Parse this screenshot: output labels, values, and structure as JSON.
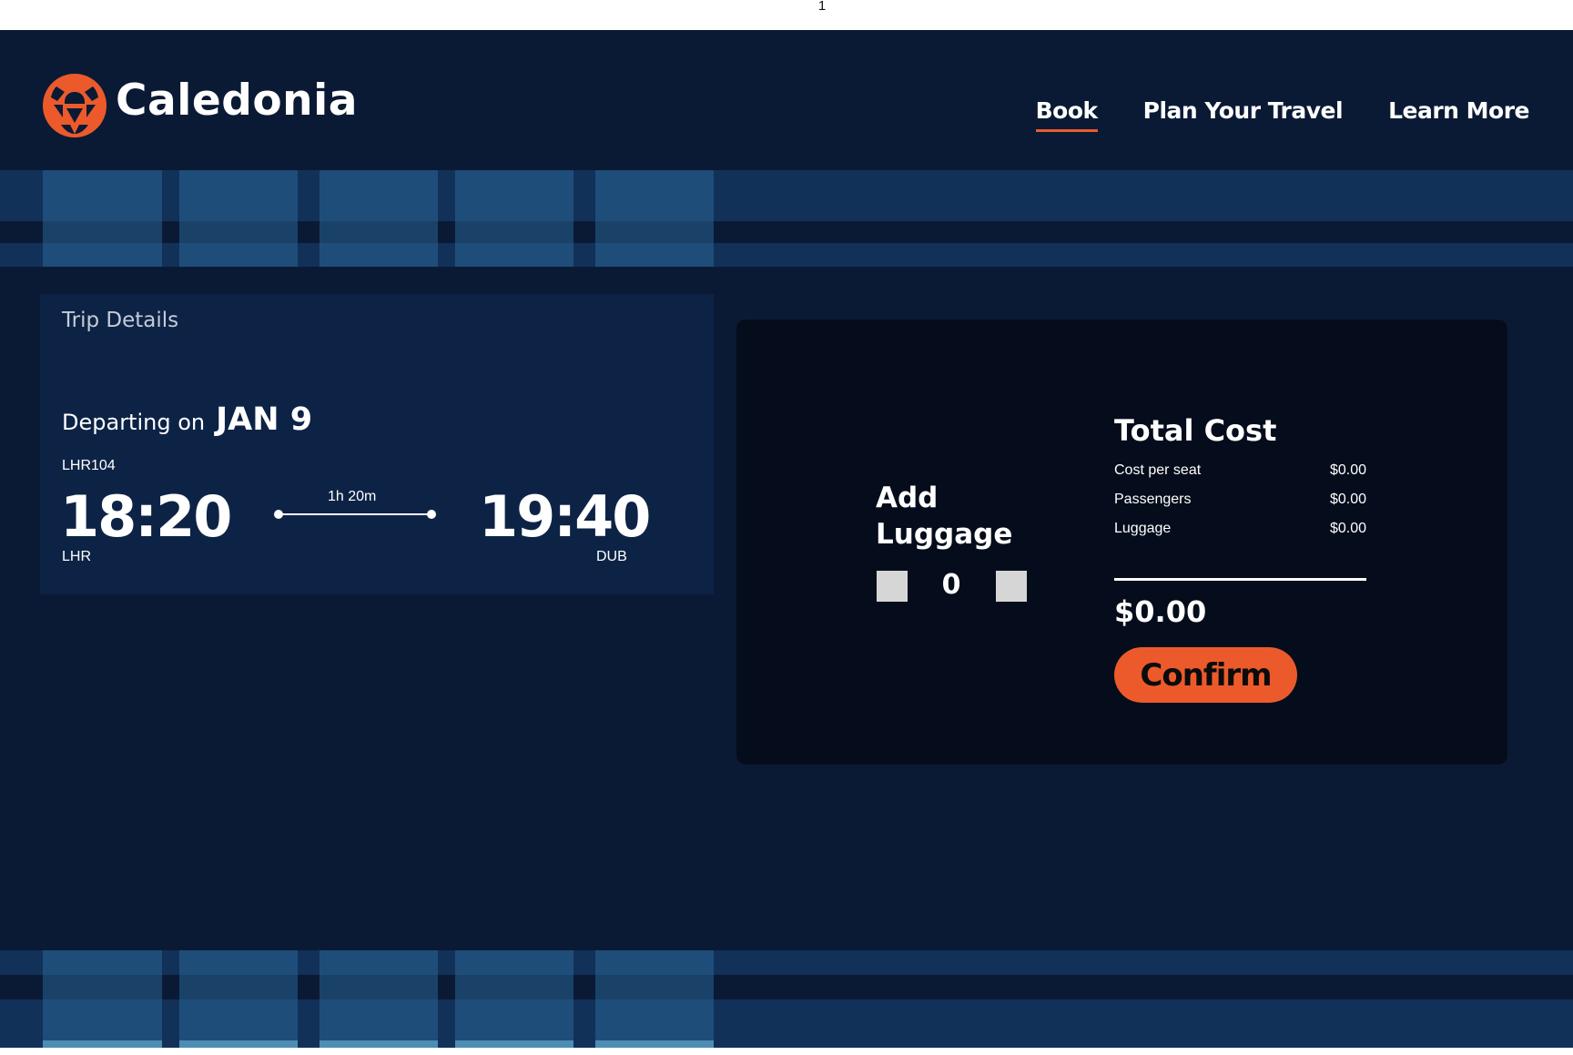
{
  "page_number": "1",
  "brand": {
    "name": "Caledonia",
    "icon": "caledonia-logo-icon",
    "accent": "#ec5a2c"
  },
  "nav": {
    "items": [
      {
        "label": "Book",
        "active": true
      },
      {
        "label": "Plan Your Travel",
        "active": false
      },
      {
        "label": "Learn More",
        "active": false
      }
    ]
  },
  "trip": {
    "title": "Trip Details",
    "departing_label": "Departing on",
    "date": "JAN 9",
    "flight_number": "LHR104",
    "departure_time": "18:20",
    "arrival_time": "19:40",
    "duration": "1h 20m",
    "origin": "LHR",
    "destination": "DUB"
  },
  "luggage": {
    "title": "Add Luggage",
    "count": "0"
  },
  "cost": {
    "title": "Total Cost",
    "rows": [
      {
        "label": "Cost per seat",
        "value": "$0.00"
      },
      {
        "label": "Passengers",
        "value": "$0.00"
      },
      {
        "label": "Luggage",
        "value": "$0.00"
      }
    ],
    "total": "$0.00",
    "confirm_label": "Confirm"
  },
  "colors": {
    "background": "#0b1a34",
    "panel": "#050d1c",
    "card": "#0d2346",
    "accent": "#ec5a2c"
  }
}
